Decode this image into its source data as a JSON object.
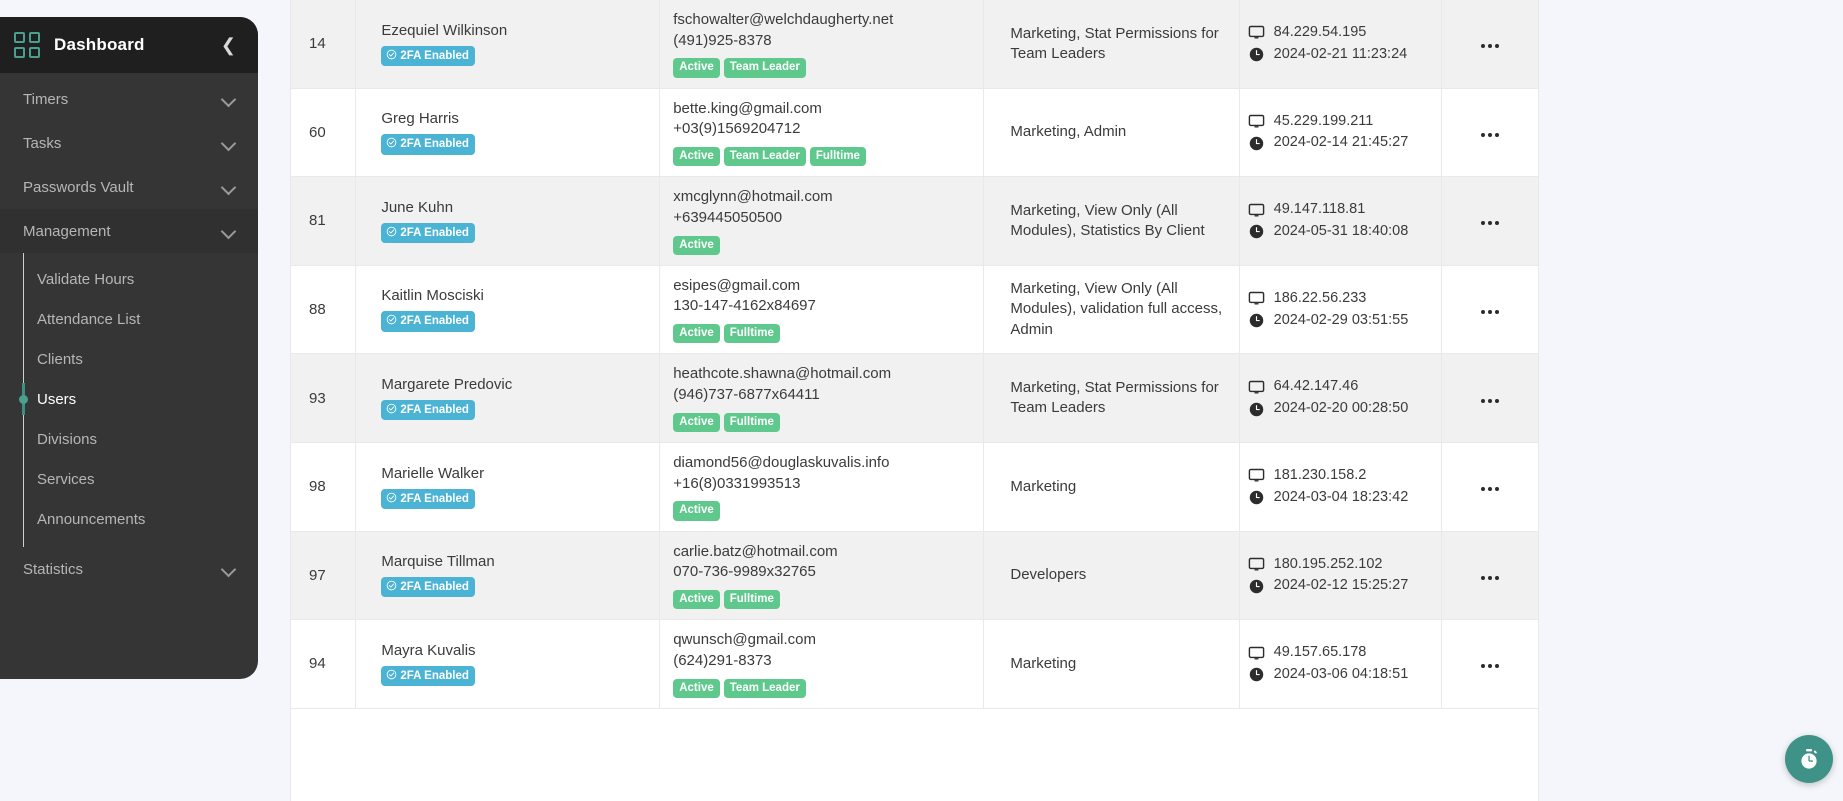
{
  "sidebar": {
    "title": "Dashboard",
    "logo_icon": "grid-icon",
    "collapse_icon": "chevron-left-icon",
    "groups": [
      {
        "label": "Timers",
        "icon": "chevron-down-icon"
      },
      {
        "label": "Tasks",
        "icon": "chevron-down-icon"
      },
      {
        "label": "Passwords Vault",
        "icon": "chevron-down-icon"
      },
      {
        "label": "Management",
        "icon": "chevron-down-icon"
      }
    ],
    "management_items": [
      "Validate Hours",
      "Attendance List",
      "Clients",
      "Users",
      "Divisions",
      "Services",
      "Announcements"
    ],
    "active_item": "Users",
    "statistics": {
      "label": "Statistics",
      "icon": "chevron-down-icon"
    },
    "accent_color": "#4aa08f"
  },
  "table": {
    "badge_colors": {
      "twofa": "#4bb3d4",
      "status": "#5fc98d"
    },
    "action_icon": "ellipsis-icon",
    "ip_icon": "monitor-icon",
    "time_icon": "clock-icon",
    "rows": [
      {
        "id": "14",
        "name": "Ezequiel Wilkinson",
        "twofa": "2FA Enabled",
        "email": "fschowalter@welchdaugherty.net",
        "phone": "(491)925-8378",
        "tags": [
          "Active",
          "Team Leader"
        ],
        "permissions": "Marketing, Stat Permissions for Team Leaders",
        "ip": "84.229.54.195",
        "timestamp": "2024-02-21 11:23:24"
      },
      {
        "id": "60",
        "name": "Greg Harris",
        "twofa": "2FA Enabled",
        "email": "bette.king@gmail.com",
        "phone": "+03(9)1569204712",
        "tags": [
          "Active",
          "Team Leader",
          "Fulltime"
        ],
        "permissions": "Marketing, Admin",
        "ip": "45.229.199.211",
        "timestamp": "2024-02-14 21:45:27"
      },
      {
        "id": "81",
        "name": "June Kuhn",
        "twofa": "2FA Enabled",
        "email": "xmcglynn@hotmail.com",
        "phone": "+639445050500",
        "tags": [
          "Active"
        ],
        "permissions": "Marketing, View Only (All Modules), Statistics By Client",
        "ip": "49.147.118.81",
        "timestamp": "2024-05-31 18:40:08"
      },
      {
        "id": "88",
        "name": "Kaitlin Mosciski",
        "twofa": "2FA Enabled",
        "email": "esipes@gmail.com",
        "phone": "130-147-4162x84697",
        "tags": [
          "Active",
          "Fulltime"
        ],
        "permissions": "Marketing, View Only (All Modules), validation full access, Admin",
        "ip": "186.22.56.233",
        "timestamp": "2024-02-29 03:51:55"
      },
      {
        "id": "93",
        "name": "Margarete Predovic",
        "twofa": "2FA Enabled",
        "email": "heathcote.shawna@hotmail.com",
        "phone": "(946)737-6877x64411",
        "tags": [
          "Active",
          "Fulltime"
        ],
        "permissions": "Marketing, Stat Permissions for Team Leaders",
        "ip": "64.42.147.46",
        "timestamp": "2024-02-20 00:28:50"
      },
      {
        "id": "98",
        "name": "Marielle Walker",
        "twofa": "2FA Enabled",
        "email": "diamond56@douglaskuvalis.info",
        "phone": "+16(8)0331993513",
        "tags": [
          "Active"
        ],
        "permissions": "Marketing",
        "ip": "181.230.158.2",
        "timestamp": "2024-03-04 18:23:42"
      },
      {
        "id": "97",
        "name": "Marquise Tillman",
        "twofa": "2FA Enabled",
        "email": "carlie.batz@hotmail.com",
        "phone": "070-736-9989x32765",
        "tags": [
          "Active",
          "Fulltime"
        ],
        "permissions": "Developers",
        "ip": "180.195.252.102",
        "timestamp": "2024-02-12 15:25:27"
      },
      {
        "id": "94",
        "name": "Mayra Kuvalis",
        "twofa": "2FA Enabled",
        "email": "qwunsch@gmail.com",
        "phone": "(624)291-8373",
        "tags": [
          "Active",
          "Team Leader"
        ],
        "permissions": "Marketing",
        "ip": "49.157.65.178",
        "timestamp": "2024-03-06 04:18:51"
      }
    ]
  },
  "fab": {
    "icon": "stopwatch-icon",
    "color": "#3f9287"
  }
}
